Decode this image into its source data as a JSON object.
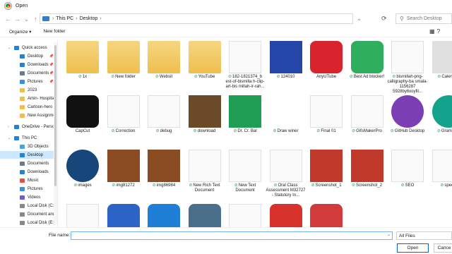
{
  "window": {
    "title": "Open"
  },
  "nav": {
    "back": "←",
    "forward": "→",
    "recent": "⌄",
    "up": "↑",
    "crumbs": [
      "This PC",
      "Desktop"
    ],
    "separator": "›",
    "expand": "⌄",
    "refresh": "⟳",
    "search_placeholder": "Search Desktop"
  },
  "toolbar": {
    "organize": "Organize ▾",
    "new_folder": "New folder",
    "view_icon": "▦",
    "help_icon": "?"
  },
  "sidebar": {
    "items": [
      {
        "label": "Quick access",
        "icon": "star-icon",
        "color": "#2a7fd4",
        "chev": "⌄"
      },
      {
        "label": "Desktop",
        "icon": "desktop-icon",
        "color": "#2a7fd4",
        "pin": true
      },
      {
        "label": "Downloads",
        "icon": "download-icon",
        "color": "#2a7fd4",
        "pin": true
      },
      {
        "label": "Documents",
        "icon": "documents-icon",
        "color": "#6c7b8b",
        "pin": true
      },
      {
        "label": "Pictures",
        "icon": "pictures-icon",
        "color": "#3b8fd6",
        "pin": true
      },
      {
        "label": "2023",
        "icon": "folder-icon",
        "color": "#efbf4e"
      },
      {
        "label": "Amin- Hospitali",
        "icon": "folder-icon",
        "color": "#efbf4e"
      },
      {
        "label": "Cartoon-hero",
        "icon": "folder-icon",
        "color": "#efbf4e"
      },
      {
        "label": "New Assignmen",
        "icon": "folder-icon",
        "color": "#efbf4e"
      },
      {
        "label": "OneDrive - Person",
        "icon": "cloud-icon",
        "color": "#2a7fd4",
        "chev": "›"
      },
      {
        "label": "This PC",
        "icon": "pc-icon",
        "color": "#2a7fd4",
        "chev": "⌄"
      },
      {
        "label": "3D Objects",
        "icon": "cube-icon",
        "color": "#4aa3df"
      },
      {
        "label": "Desktop",
        "icon": "desktop-icon",
        "color": "#2a7fd4",
        "selected": true
      },
      {
        "label": "Documents",
        "icon": "documents-icon",
        "color": "#6c7b8b"
      },
      {
        "label": "Downloads",
        "icon": "download-icon",
        "color": "#2a7fd4"
      },
      {
        "label": "Music",
        "icon": "music-icon",
        "color": "#d9534f"
      },
      {
        "label": "Pictures",
        "icon": "pictures-icon",
        "color": "#3b8fd6"
      },
      {
        "label": "Videos",
        "icon": "videos-icon",
        "color": "#7a57d1"
      },
      {
        "label": "Local Disk (C:)",
        "icon": "disk-icon",
        "color": "#888888"
      },
      {
        "label": "Document and S",
        "icon": "disk-icon",
        "color": "#888888"
      },
      {
        "label": "Local Disk (E:)",
        "icon": "disk-icon",
        "color": "#888888"
      }
    ]
  },
  "files": [
    {
      "name": "1x",
      "icon": "app-file-icon",
      "sync": true
    },
    {
      "name": "New folder",
      "icon": "folder-icon",
      "sync": true
    },
    {
      "name": "Websit",
      "icon": "folder-icon",
      "sync": true
    },
    {
      "name": "YouTube",
      "icon": "folder-icon",
      "sync": true
    },
    {
      "name": "182-1821374_b est-of-bismilla h-clip-art-bis millah-ir-rah...",
      "icon": "image-icon",
      "sync": true
    },
    {
      "name": "124010",
      "icon": "blue-image-icon",
      "sync": true
    },
    {
      "name": "AnyUTube",
      "icon": "anyutube-icon"
    },
    {
      "name": "Best Ad blocker!",
      "icon": "adblock-shield-icon",
      "sync": true
    },
    {
      "name": "bismillah-png-calligraphy-ba smala-1156287 5928by6xoyfil...",
      "icon": "calligraphy-image-icon",
      "sync": true
    },
    {
      "name": "Calender",
      "icon": "calendar-icon",
      "sync": true
    },
    {
      "name": "CapCut",
      "icon": "capcut-icon"
    },
    {
      "name": "Correction",
      "icon": "doc-icon",
      "sync": true
    },
    {
      "name": "debug",
      "icon": "text-file-icon",
      "sync": true
    },
    {
      "name": "download",
      "icon": "photo-thumbnail-icon",
      "sync": true
    },
    {
      "name": "Dr. Cr. Bal",
      "icon": "spreadsheet-icon",
      "sync": true
    },
    {
      "name": "Draw winer",
      "icon": "shortcut-icon",
      "sync": true
    },
    {
      "name": "Final 01",
      "icon": "doc-icon",
      "sync": true
    },
    {
      "name": "GifsMakerPro",
      "icon": "doc-icon",
      "sync": true
    },
    {
      "name": "GitHub Desktop",
      "icon": "github-icon",
      "sync": true
    },
    {
      "name": "Grammar",
      "icon": "grammarly-icon",
      "sync": true
    },
    {
      "name": "images",
      "icon": "phone-icon",
      "sync": true
    },
    {
      "name": "img81272",
      "icon": "food-photo-icon",
      "sync": true
    },
    {
      "name": "img86984",
      "icon": "food-photo-icon",
      "sync": true
    },
    {
      "name": "New Rich Text Document",
      "icon": "doc-icon",
      "sync": true
    },
    {
      "name": "New Text Document",
      "icon": "text-file-icon",
      "sync": true
    },
    {
      "name": "Oral Class Assessment M32727 - Statutory In...",
      "icon": "doc-icon",
      "sync": true
    },
    {
      "name": "Screenshot_1",
      "icon": "screenshot-icon",
      "sync": true
    },
    {
      "name": "Screenshot_2",
      "icon": "screenshot-icon",
      "sync": true
    },
    {
      "name": "SEO",
      "icon": "doc-icon",
      "sync": true
    },
    {
      "name": "speed",
      "icon": "doc-icon",
      "sync": true
    },
    {
      "name": "",
      "icon": "doc-icon"
    },
    {
      "name": "",
      "icon": "word-icon"
    },
    {
      "name": "",
      "icon": "vscode-icon"
    },
    {
      "name": "",
      "icon": "app-icon"
    },
    {
      "name": "",
      "icon": "doc-icon"
    },
    {
      "name": "",
      "icon": "wps-icon"
    },
    {
      "name": "",
      "icon": "pdf-icon"
    }
  ],
  "footer": {
    "filename_label": "File name:",
    "filename_value": "",
    "filter": "All Files",
    "open": "Open",
    "cancel": "Cance"
  }
}
